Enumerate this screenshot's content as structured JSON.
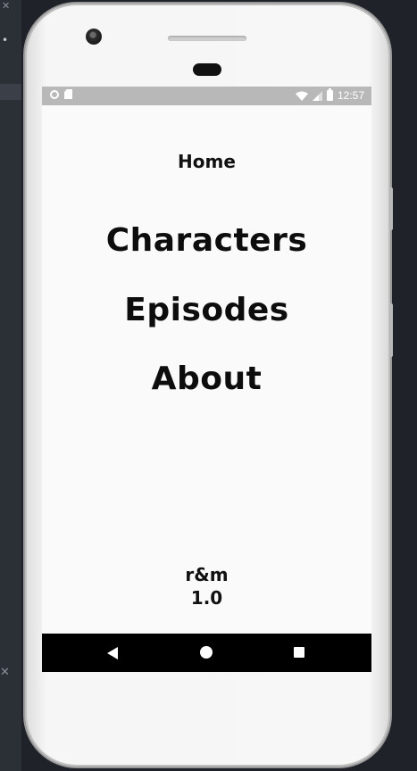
{
  "status_bar": {
    "time": "12:57",
    "icons": [
      "circle-notification-icon",
      "sd-card-icon",
      "wifi-icon",
      "signal-icon",
      "battery-icon"
    ]
  },
  "screen": {
    "title": "Home",
    "menu": [
      {
        "label": "Characters"
      },
      {
        "label": "Episodes"
      },
      {
        "label": "About"
      }
    ],
    "footer": {
      "app_name": "r&m",
      "version": "1.0"
    }
  },
  "nav_bar": {
    "buttons": [
      "back",
      "home",
      "recents"
    ]
  },
  "colors": {
    "screen_background": "#fafafa",
    "status_bar": "#b8b8b8",
    "nav_bar": "#000000",
    "text": "#111111"
  }
}
